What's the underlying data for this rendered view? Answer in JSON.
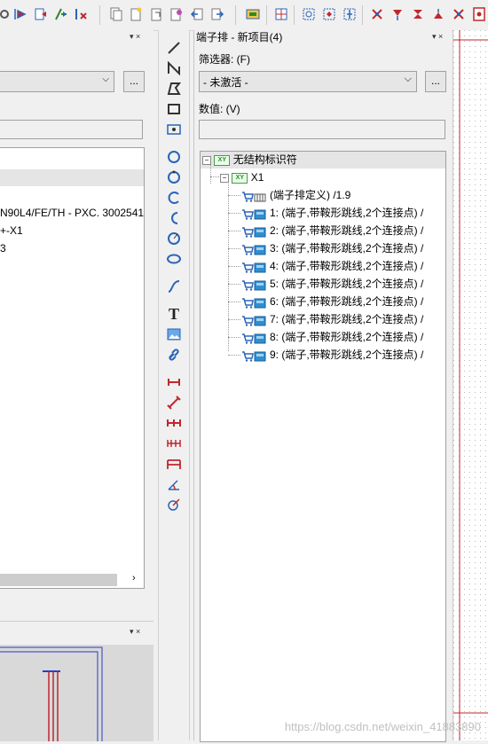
{
  "left_panel": {
    "list_lines": [
      "N90L4/FE/TH - PXC. 3002541",
      "+-X1",
      "3"
    ],
    "more_button": "...",
    "pin_controls": "▾ ×"
  },
  "main_panel": {
    "title": "端子排 - 新项目(4)",
    "pin_controls": "▾ ×",
    "filter_label": "筛选器: (F)",
    "filter_value": "- 未激活 -",
    "filter_more": "...",
    "value_label": "数值: (V)",
    "value_input": "",
    "tree": {
      "root_label": "无结构标识符",
      "node_label": "X1",
      "items": [
        "(端子排定义) /1.9",
        "1: (端子,带鞍形跳线,2个连接点) /",
        "2: (端子,带鞍形跳线,2个连接点) /",
        "3: (端子,带鞍形跳线,2个连接点) /",
        "4: (端子,带鞍形跳线,2个连接点) /",
        "5: (端子,带鞍形跳线,2个连接点) /",
        "6: (端子,带鞍形跳线,2个连接点) /",
        "7: (端子,带鞍形跳线,2个连接点) /",
        "8: (端子,带鞍形跳线,2个连接点) /",
        "9: (端子,带鞍形跳线,2个连接点) /"
      ],
      "xy_badge": "XY"
    }
  },
  "watermark": "https://blog.csdn.net/weixin_41883890",
  "colors": {
    "accent_red": "#c0282d",
    "accent_blue": "#2b64b8",
    "tree_green": "#2a8a2a"
  }
}
